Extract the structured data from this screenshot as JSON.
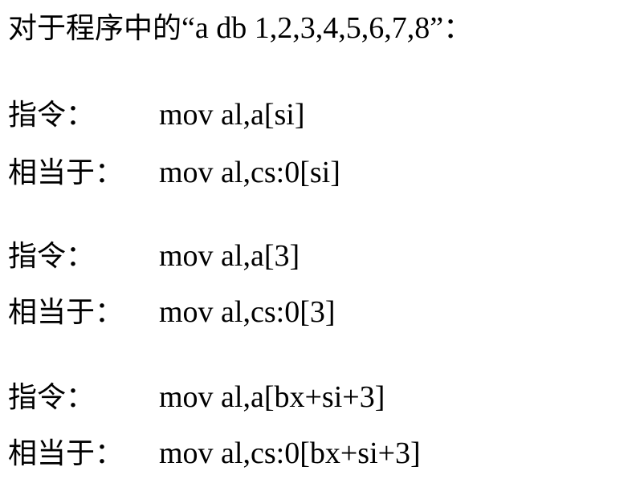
{
  "intro": {
    "prefix": "对于程序中的",
    "quote_open": "“",
    "code": "a db 1,2,3,4,5,6,7,8",
    "quote_close": "”",
    "suffix": "："
  },
  "examples": [
    {
      "instruction_label": "指令：",
      "instruction_code": "mov al,a[si]",
      "equivalent_label": "相当于：",
      "equivalent_code": "mov al,cs:0[si]"
    },
    {
      "instruction_label": "指令：",
      "instruction_code": "mov al,a[3]",
      "equivalent_label": "相当于：",
      "equivalent_code": "mov al,cs:0[3]"
    },
    {
      "instruction_label": "指令：",
      "instruction_code": "mov al,a[bx+si+3]",
      "equivalent_label": "相当于：",
      "equivalent_code": "mov al,cs:0[bx+si+3]"
    }
  ]
}
